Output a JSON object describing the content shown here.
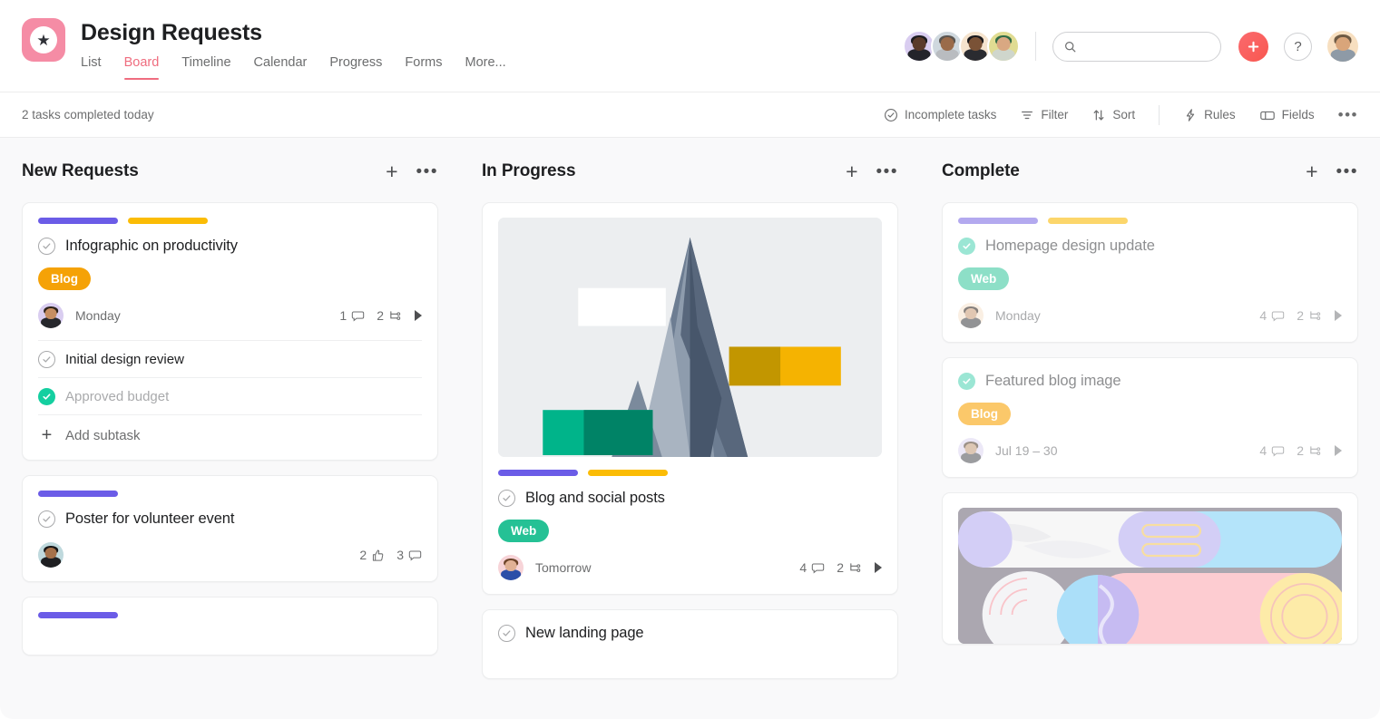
{
  "header": {
    "logo_icon": "star-icon",
    "project_title": "Design Requests",
    "tabs": [
      {
        "label": "List",
        "active": false
      },
      {
        "label": "Board",
        "active": true
      },
      {
        "label": "Timeline",
        "active": false
      },
      {
        "label": "Calendar",
        "active": false
      },
      {
        "label": "Progress",
        "active": false
      },
      {
        "label": "Forms",
        "active": false
      },
      {
        "label": "More...",
        "active": false
      }
    ],
    "members": [
      {
        "name": "member-1",
        "bg": "#d9cdf0",
        "skin": "#5a3a2a",
        "hair": "#1c1c20",
        "body": "#23242a"
      },
      {
        "name": "member-2",
        "bg": "#cfd8de",
        "skin": "#9a6b4a",
        "hair": "#5a5550",
        "body": "#b9bcc0"
      },
      {
        "name": "member-3",
        "bg": "#f5e3cd",
        "skin": "#7a5236",
        "hair": "#18181c",
        "body": "#2a2b30"
      },
      {
        "name": "member-4",
        "bg": "#e0dc92",
        "skin": "#d9a882",
        "hair": "#2f6b46",
        "body": "#cfd6cc"
      }
    ],
    "search": {
      "value": "",
      "placeholder": ""
    },
    "add_button_icon": "plus-icon",
    "help_button_label": "?",
    "current_user": {
      "name": "current-user",
      "bg": "#f7dfc0",
      "skin": "#d9a57a",
      "hair": "#6e5a44",
      "body": "#8e9aa6"
    },
    "accent_pink": "#ef6d7f",
    "accent_red": "#f8574f"
  },
  "toolbar": {
    "status_text": "2 tasks completed today",
    "items": [
      {
        "label": "Incomplete tasks",
        "icon": "check-circle-icon"
      },
      {
        "label": "Filter",
        "icon": "filter-icon"
      },
      {
        "label": "Sort",
        "icon": "sort-icon"
      },
      {
        "label": "Rules",
        "icon": "bolt-icon"
      },
      {
        "label": "Fields",
        "icon": "fields-icon"
      }
    ],
    "overflow_label": "•••"
  },
  "board": {
    "columns": [
      {
        "title": "New Requests",
        "add_icon": "plus-icon",
        "menu_icon": "ellipsis-icon",
        "cards": [
          {
            "title": "Infographic on productivity",
            "completed": false,
            "tagbars": [
              "#6b5ce7",
              "#fbbc05"
            ],
            "pill": {
              "label": "Blog",
              "bg": "#f5a207"
            },
            "assignee": {
              "name": "assignee-infographic",
              "bg": "#d9cdf0",
              "skin": "#c68e62",
              "hair": "#2b2118",
              "body": "#26272c"
            },
            "due": "Monday",
            "meta": [
              {
                "count": "1",
                "icon": "comment-icon"
              },
              {
                "count": "2",
                "icon": "subtask-icon"
              }
            ],
            "expand_icon": "caret-right-icon",
            "subtasks": [
              {
                "label": "Initial design review",
                "done": false
              },
              {
                "label": "Approved budget",
                "done": true
              }
            ],
            "add_subtask_label": "Add subtask"
          },
          {
            "title": "Poster for volunteer event",
            "completed": false,
            "tagbars": [
              "#6b5ce7"
            ],
            "assignee": {
              "name": "assignee-poster",
              "bg": "#bfd9dd",
              "skin": "#a5714a",
              "hair": "#161617",
              "body": "#1e1f22"
            },
            "meta": [
              {
                "count": "2",
                "icon": "thumbs-up-icon"
              },
              {
                "count": "3",
                "icon": "comment-icon"
              }
            ]
          },
          {
            "title": "",
            "completed": false,
            "tagbars": [
              "#6b5ce7"
            ],
            "partial": true
          }
        ]
      },
      {
        "title": "In Progress",
        "add_icon": "plus-icon",
        "menu_icon": "ellipsis-icon",
        "cards": [
          {
            "title": "Blog and social posts",
            "completed": false,
            "image": "mountain-collage-image",
            "tagbars": [
              "#6b5ce7",
              "#fbbc05"
            ],
            "pill": {
              "label": "Web",
              "bg": "#25c195"
            },
            "assignee": {
              "name": "assignee-blog-social",
              "bg": "#f7d4d8",
              "skin": "#e0b195",
              "hair": "#6b4227",
              "body": "#2c4ea8"
            },
            "due": "Tomorrow",
            "meta": [
              {
                "count": "4",
                "icon": "comment-icon"
              },
              {
                "count": "2",
                "icon": "subtask-icon"
              }
            ],
            "expand_icon": "caret-right-icon"
          },
          {
            "title": "New landing page",
            "completed": false,
            "partial": true
          }
        ]
      },
      {
        "title": "Complete",
        "add_icon": "plus-icon",
        "menu_icon": "ellipsis-icon",
        "cards": [
          {
            "title": "Homepage design update",
            "completed": true,
            "tagbars": [
              "#b3a9ef",
              "#fcd66b"
            ],
            "pill": {
              "label": "Web",
              "bg": "#8ddfc7"
            },
            "assignee": {
              "name": "assignee-homepage",
              "bg": "#f7e3cd",
              "skin": "#c99a74",
              "hair": "#231a14",
              "body": "#3a3b40"
            },
            "due": "Monday",
            "meta": [
              {
                "count": "4",
                "icon": "comment-icon"
              },
              {
                "count": "2",
                "icon": "subtask-icon"
              }
            ],
            "expand_icon": "caret-right-icon"
          },
          {
            "title": "Featured blog image",
            "completed": true,
            "pill": {
              "label": "Blog",
              "bg": "#fbc86a"
            },
            "assignee": {
              "name": "assignee-featured-blog",
              "bg": "#ded7f2",
              "skin": "#c29a78",
              "hair": "#4a3626",
              "body": "#4b4c52"
            },
            "due": "Jul 19 – 30",
            "meta": [
              {
                "count": "4",
                "icon": "comment-icon"
              },
              {
                "count": "2",
                "icon": "subtask-icon"
              }
            ],
            "expand_icon": "caret-right-icon"
          },
          {
            "title": "",
            "completed": true,
            "image": "abstract-shapes-image",
            "partial": true
          }
        ]
      }
    ]
  }
}
